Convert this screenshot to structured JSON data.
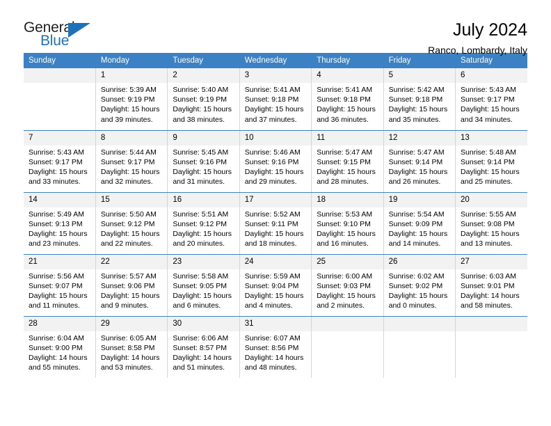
{
  "brand": {
    "name_part1": "General",
    "name_part2": "Blue",
    "triangle_color": "#1c72bb",
    "text_color": "#231f20"
  },
  "header": {
    "title": "July 2024",
    "location": "Ranco, Lombardy, Italy"
  },
  "theme": {
    "header_row_color": "#3c81c3",
    "daynum_band_color": "#f2f2f2",
    "grid_line_color": "#d5d5d5"
  },
  "weekday_headers": [
    "Sunday",
    "Monday",
    "Tuesday",
    "Wednesday",
    "Thursday",
    "Friday",
    "Saturday"
  ],
  "labels": {
    "sunrise_prefix": "Sunrise:",
    "sunset_prefix": "Sunset:",
    "daylight_prefix": "Daylight:"
  },
  "weeks": [
    [
      {
        "day": "",
        "sunrise": "",
        "sunset": "",
        "daylight_line1": "",
        "daylight_line2": ""
      },
      {
        "day": "1",
        "sunrise": "Sunrise: 5:39 AM",
        "sunset": "Sunset: 9:19 PM",
        "daylight_line1": "Daylight: 15 hours",
        "daylight_line2": "and 39 minutes."
      },
      {
        "day": "2",
        "sunrise": "Sunrise: 5:40 AM",
        "sunset": "Sunset: 9:19 PM",
        "daylight_line1": "Daylight: 15 hours",
        "daylight_line2": "and 38 minutes."
      },
      {
        "day": "3",
        "sunrise": "Sunrise: 5:41 AM",
        "sunset": "Sunset: 9:18 PM",
        "daylight_line1": "Daylight: 15 hours",
        "daylight_line2": "and 37 minutes."
      },
      {
        "day": "4",
        "sunrise": "Sunrise: 5:41 AM",
        "sunset": "Sunset: 9:18 PM",
        "daylight_line1": "Daylight: 15 hours",
        "daylight_line2": "and 36 minutes."
      },
      {
        "day": "5",
        "sunrise": "Sunrise: 5:42 AM",
        "sunset": "Sunset: 9:18 PM",
        "daylight_line1": "Daylight: 15 hours",
        "daylight_line2": "and 35 minutes."
      },
      {
        "day": "6",
        "sunrise": "Sunrise: 5:43 AM",
        "sunset": "Sunset: 9:17 PM",
        "daylight_line1": "Daylight: 15 hours",
        "daylight_line2": "and 34 minutes."
      }
    ],
    [
      {
        "day": "7",
        "sunrise": "Sunrise: 5:43 AM",
        "sunset": "Sunset: 9:17 PM",
        "daylight_line1": "Daylight: 15 hours",
        "daylight_line2": "and 33 minutes."
      },
      {
        "day": "8",
        "sunrise": "Sunrise: 5:44 AM",
        "sunset": "Sunset: 9:17 PM",
        "daylight_line1": "Daylight: 15 hours",
        "daylight_line2": "and 32 minutes."
      },
      {
        "day": "9",
        "sunrise": "Sunrise: 5:45 AM",
        "sunset": "Sunset: 9:16 PM",
        "daylight_line1": "Daylight: 15 hours",
        "daylight_line2": "and 31 minutes."
      },
      {
        "day": "10",
        "sunrise": "Sunrise: 5:46 AM",
        "sunset": "Sunset: 9:16 PM",
        "daylight_line1": "Daylight: 15 hours",
        "daylight_line2": "and 29 minutes."
      },
      {
        "day": "11",
        "sunrise": "Sunrise: 5:47 AM",
        "sunset": "Sunset: 9:15 PM",
        "daylight_line1": "Daylight: 15 hours",
        "daylight_line2": "and 28 minutes."
      },
      {
        "day": "12",
        "sunrise": "Sunrise: 5:47 AM",
        "sunset": "Sunset: 9:14 PM",
        "daylight_line1": "Daylight: 15 hours",
        "daylight_line2": "and 26 minutes."
      },
      {
        "day": "13",
        "sunrise": "Sunrise: 5:48 AM",
        "sunset": "Sunset: 9:14 PM",
        "daylight_line1": "Daylight: 15 hours",
        "daylight_line2": "and 25 minutes."
      }
    ],
    [
      {
        "day": "14",
        "sunrise": "Sunrise: 5:49 AM",
        "sunset": "Sunset: 9:13 PM",
        "daylight_line1": "Daylight: 15 hours",
        "daylight_line2": "and 23 minutes."
      },
      {
        "day": "15",
        "sunrise": "Sunrise: 5:50 AM",
        "sunset": "Sunset: 9:12 PM",
        "daylight_line1": "Daylight: 15 hours",
        "daylight_line2": "and 22 minutes."
      },
      {
        "day": "16",
        "sunrise": "Sunrise: 5:51 AM",
        "sunset": "Sunset: 9:12 PM",
        "daylight_line1": "Daylight: 15 hours",
        "daylight_line2": "and 20 minutes."
      },
      {
        "day": "17",
        "sunrise": "Sunrise: 5:52 AM",
        "sunset": "Sunset: 9:11 PM",
        "daylight_line1": "Daylight: 15 hours",
        "daylight_line2": "and 18 minutes."
      },
      {
        "day": "18",
        "sunrise": "Sunrise: 5:53 AM",
        "sunset": "Sunset: 9:10 PM",
        "daylight_line1": "Daylight: 15 hours",
        "daylight_line2": "and 16 minutes."
      },
      {
        "day": "19",
        "sunrise": "Sunrise: 5:54 AM",
        "sunset": "Sunset: 9:09 PM",
        "daylight_line1": "Daylight: 15 hours",
        "daylight_line2": "and 14 minutes."
      },
      {
        "day": "20",
        "sunrise": "Sunrise: 5:55 AM",
        "sunset": "Sunset: 9:08 PM",
        "daylight_line1": "Daylight: 15 hours",
        "daylight_line2": "and 13 minutes."
      }
    ],
    [
      {
        "day": "21",
        "sunrise": "Sunrise: 5:56 AM",
        "sunset": "Sunset: 9:07 PM",
        "daylight_line1": "Daylight: 15 hours",
        "daylight_line2": "and 11 minutes."
      },
      {
        "day": "22",
        "sunrise": "Sunrise: 5:57 AM",
        "sunset": "Sunset: 9:06 PM",
        "daylight_line1": "Daylight: 15 hours",
        "daylight_line2": "and 9 minutes."
      },
      {
        "day": "23",
        "sunrise": "Sunrise: 5:58 AM",
        "sunset": "Sunset: 9:05 PM",
        "daylight_line1": "Daylight: 15 hours",
        "daylight_line2": "and 6 minutes."
      },
      {
        "day": "24",
        "sunrise": "Sunrise: 5:59 AM",
        "sunset": "Sunset: 9:04 PM",
        "daylight_line1": "Daylight: 15 hours",
        "daylight_line2": "and 4 minutes."
      },
      {
        "day": "25",
        "sunrise": "Sunrise: 6:00 AM",
        "sunset": "Sunset: 9:03 PM",
        "daylight_line1": "Daylight: 15 hours",
        "daylight_line2": "and 2 minutes."
      },
      {
        "day": "26",
        "sunrise": "Sunrise: 6:02 AM",
        "sunset": "Sunset: 9:02 PM",
        "daylight_line1": "Daylight: 15 hours",
        "daylight_line2": "and 0 minutes."
      },
      {
        "day": "27",
        "sunrise": "Sunrise: 6:03 AM",
        "sunset": "Sunset: 9:01 PM",
        "daylight_line1": "Daylight: 14 hours",
        "daylight_line2": "and 58 minutes."
      }
    ],
    [
      {
        "day": "28",
        "sunrise": "Sunrise: 6:04 AM",
        "sunset": "Sunset: 9:00 PM",
        "daylight_line1": "Daylight: 14 hours",
        "daylight_line2": "and 55 minutes."
      },
      {
        "day": "29",
        "sunrise": "Sunrise: 6:05 AM",
        "sunset": "Sunset: 8:58 PM",
        "daylight_line1": "Daylight: 14 hours",
        "daylight_line2": "and 53 minutes."
      },
      {
        "day": "30",
        "sunrise": "Sunrise: 6:06 AM",
        "sunset": "Sunset: 8:57 PM",
        "daylight_line1": "Daylight: 14 hours",
        "daylight_line2": "and 51 minutes."
      },
      {
        "day": "31",
        "sunrise": "Sunrise: 6:07 AM",
        "sunset": "Sunset: 8:56 PM",
        "daylight_line1": "Daylight: 14 hours",
        "daylight_line2": "and 48 minutes."
      },
      {
        "day": "",
        "sunrise": "",
        "sunset": "",
        "daylight_line1": "",
        "daylight_line2": ""
      },
      {
        "day": "",
        "sunrise": "",
        "sunset": "",
        "daylight_line1": "",
        "daylight_line2": ""
      },
      {
        "day": "",
        "sunrise": "",
        "sunset": "",
        "daylight_line1": "",
        "daylight_line2": ""
      }
    ]
  ]
}
